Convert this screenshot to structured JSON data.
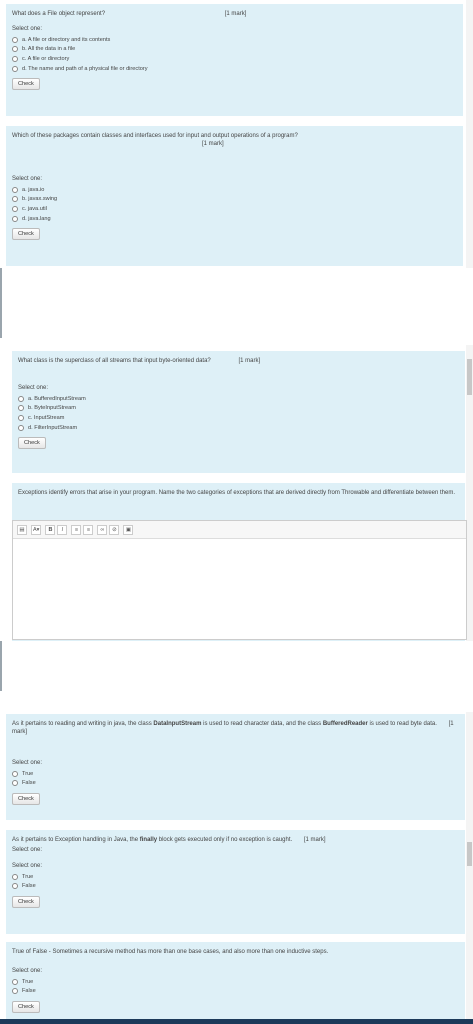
{
  "q1": {
    "text": "What does a File object represent?",
    "mark": "[1 mark]",
    "select": "Select one:",
    "options": [
      "a. A file or directory and its contents",
      "b. All the data in a file",
      "c. A file or directory",
      "d. The name and path of a physical file or directory"
    ],
    "check": "Check"
  },
  "q2": {
    "text": "Which of these packages contain classes and interfaces used for input and output operations of a program?",
    "mark": "[1 mark]",
    "select": "Select one:",
    "options": [
      "a. java.io",
      "b. javax.swing",
      "c. java.util",
      "d. java.lang"
    ],
    "check": "Check"
  },
  "q3": {
    "text": "What class is the superclass of all streams that input byte-oriented data?",
    "mark": "[1 mark]",
    "select": "Select one:",
    "options": [
      "a. BufferedInputStream",
      "b. ByteInputStream",
      "c. InputStream",
      "d. FilterInputStream"
    ],
    "check": "Check"
  },
  "q4": {
    "text": "Exceptions identify errors that arise in your program. Name the two categories of exceptions that are derived directly from Throwable and differentiate between them."
  },
  "toolbar": {
    "font_size": "A",
    "bold": "B",
    "italic": "I"
  },
  "q5": {
    "text_a": "As it pertains to reading and writing in java, the class ",
    "bold_a": "DataInputStream",
    "text_b": " is used to read character data, and the class ",
    "bold_b": "BufferedReader",
    "text_c": " is used to read byte data.",
    "mark": "[1 mark]",
    "select": "Select one:",
    "options": [
      "True",
      "False"
    ],
    "check": "Check"
  },
  "q6": {
    "text_a": "As it pertains to Exception handling in Java, the ",
    "bold_a": "finally",
    "text_b": " block gets executed only if no exception is caught.",
    "mark": "[1 mark]",
    "select": "Select one:",
    "options": [
      "True",
      "False"
    ],
    "check": "Check"
  },
  "q7": {
    "text": "True of False - Sometimes a recursive method has more than one base cases, and also more than one inductive steps.",
    "select": "Select one:",
    "options": [
      "True",
      "False"
    ],
    "check": "Check"
  },
  "colors": {
    "panel": "#def0f7",
    "taskbar": "#1c3a5a"
  }
}
